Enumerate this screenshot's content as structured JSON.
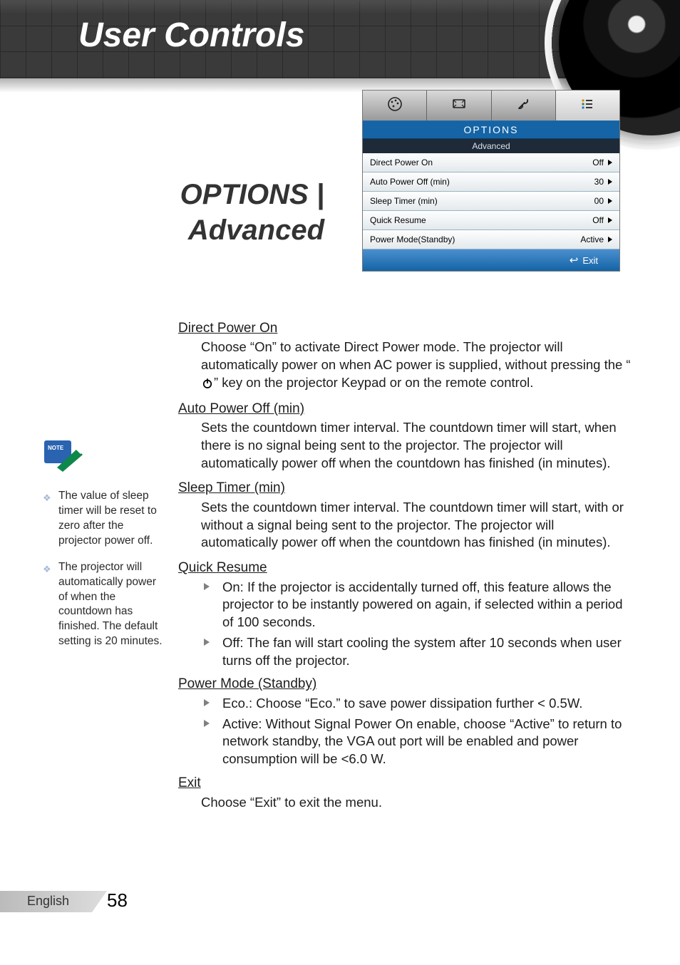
{
  "header": {
    "title": "User Controls"
  },
  "section_title_line1": "OPTIONS |",
  "section_title_line2": "Advanced",
  "osd": {
    "header": "OPTIONS",
    "sub": "Advanced",
    "rows": [
      {
        "label": "Direct Power On",
        "value": "Off"
      },
      {
        "label": "Auto Power Off (min)",
        "value": "30"
      },
      {
        "label": "Sleep Timer (min)",
        "value": "00"
      },
      {
        "label": "Quick Resume",
        "value": "Off"
      },
      {
        "label": "Power Mode(Standby)",
        "value": "Active"
      }
    ],
    "exit": "Exit"
  },
  "sections": {
    "s1": {
      "h": "Direct Power On",
      "p_before": "Choose “On” to activate Direct Power mode. The projector will automatically power on when AC power is supplied, without pressing the “",
      "p_after": "” key on the projector Keypad or on the remote control."
    },
    "s2": {
      "h": "Auto Power Off (min)",
      "p": "Sets the countdown timer interval. The countdown timer will start, when there is no signal being sent to the projector. The projector will automatically power off when the countdown has finished (in minutes)."
    },
    "s3": {
      "h": "Sleep Timer (min)",
      "p": "Sets the countdown timer interval. The countdown timer will start, with or without a signal being sent to the projector. The projector will automatically power off when the countdown has finished (in minutes)."
    },
    "s4": {
      "h": "Quick Resume",
      "b1": "On: If the projector is accidentally turned off, this feature allows the projector to be instantly powered on again, if selected within a period of 100 seconds.",
      "b2": "Off: The fan will start cooling the system after 10 seconds when user turns off the projector."
    },
    "s5": {
      "h": "Power Mode (Standby)",
      "b1": "Eco.: Choose “Eco.” to save power dissipation further < 0.5W.",
      "b2": "Active: Without Signal Power On enable, choose “Active” to return to network standby,  the VGA out port will be enabled and power consumption will be <6.0 W."
    },
    "s6": {
      "h": "Exit",
      "p": "Choose “Exit” to exit the menu."
    }
  },
  "notes": {
    "n1": "The value of sleep timer will be reset to zero after the projector power off.",
    "n2": "The projector will automatically power of when the countdown has finished. The default setting is 20 minutes."
  },
  "footer": {
    "lang": "English",
    "page": "58"
  }
}
